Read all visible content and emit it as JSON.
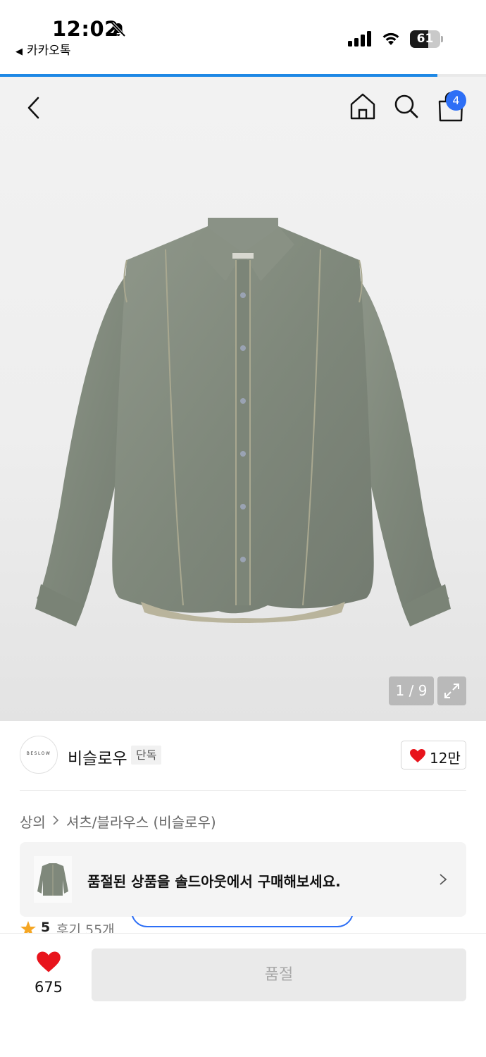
{
  "status_bar": {
    "time": "12:02",
    "back_app": "카카오톡",
    "battery": "61",
    "battery_fraction": 0.61,
    "icons": [
      "bell-slash-icon",
      "signal-icon",
      "wifi-icon",
      "battery-icon"
    ]
  },
  "loading": {
    "progress": 0.9
  },
  "nav": {
    "icons": [
      "chevron-left-icon",
      "home-icon",
      "search-icon",
      "shopping-bag-icon"
    ],
    "cart_count": "4"
  },
  "product_image": {
    "pager": "1 / 9",
    "icons": [
      "expand-icon"
    ]
  },
  "brand": {
    "logo_text": "BESLOW",
    "name": "비슬로우",
    "tag": "단독",
    "likes": "12만"
  },
  "breadcrumb": {
    "category": "상의",
    "subcategory": "셔츠/블라우스 (비슬로우)"
  },
  "banner": {
    "message": "품절된 상품을 솔드아웃에서 구매해보세요."
  },
  "review": {
    "score": "5",
    "count": "후기 55개"
  },
  "bottom": {
    "likes": "675",
    "buy_label": "품절"
  },
  "colors": {
    "accent": "#2d6ff6",
    "heart": "#e8141c",
    "progress": "#1e88e5",
    "star": "#f5a623"
  }
}
